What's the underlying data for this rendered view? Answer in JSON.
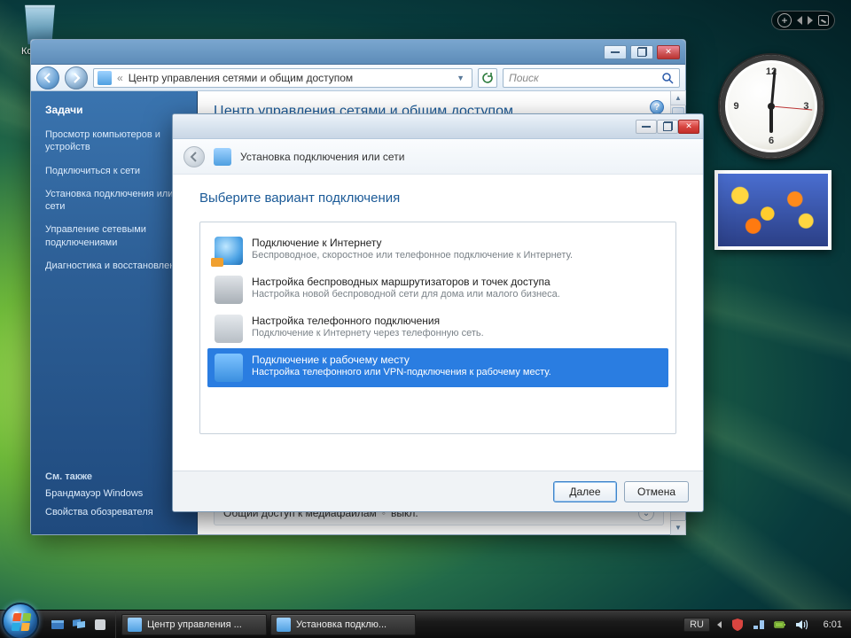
{
  "desktop": {
    "recycle_bin": "Корзина"
  },
  "parent_window": {
    "address": "Центр управления сетями и общим доступом",
    "search_placeholder": "Поиск",
    "heading": "Центр управления сетями и общим доступом",
    "sidebar": {
      "tasks_header": "Задачи",
      "items": [
        "Просмотр компьютеров и устройств",
        "Подключиться к сети",
        "Установка подключения или сети",
        "Управление сетевыми подключениями",
        "Диагностика и восстановление"
      ],
      "see_also_header": "См. также",
      "see_also": [
        "Брандмауэр Windows",
        "Свойства обозревателя"
      ]
    },
    "media_row": {
      "label": "Общий доступ к медиафайлам",
      "value": "выкл."
    }
  },
  "wizard": {
    "title": "Установка подключения или сети",
    "heading": "Выберите вариант подключения",
    "options": [
      {
        "title": "Подключение к Интернету",
        "desc": "Беспроводное, скоростное или телефонное подключение к Интернету."
      },
      {
        "title": "Настройка беспроводных маршрутизаторов и точек доступа",
        "desc": "Настройка новой беспроводной сети для дома или малого бизнеса."
      },
      {
        "title": "Настройка телефонного подключения",
        "desc": "Подключение к Интернету через телефонную сеть."
      },
      {
        "title": "Подключение к рабочему месту",
        "desc": "Настройка телефонного или VPN-подключения к рабочему месту."
      }
    ],
    "selected_index": 3,
    "buttons": {
      "next": "Далее",
      "cancel": "Отмена"
    }
  },
  "taskbar": {
    "items": [
      "Центр управления ...",
      "Установка подклю..."
    ],
    "lang": "RU",
    "time": "6:01"
  }
}
